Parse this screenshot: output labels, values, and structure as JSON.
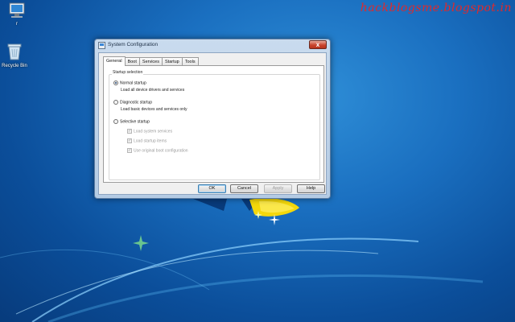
{
  "watermark": "hackblogsme.blogspot.in",
  "desktop": {
    "icons": [
      {
        "name": "computer-icon",
        "label": "r"
      },
      {
        "name": "recycle-bin-icon",
        "label": "Recycle Bin"
      }
    ]
  },
  "window": {
    "title": "System Configuration",
    "close_label": "x",
    "tabs": [
      {
        "label": "General",
        "active": true
      },
      {
        "label": "Boot",
        "active": false
      },
      {
        "label": "Services",
        "active": false
      },
      {
        "label": "Startup",
        "active": false
      },
      {
        "label": "Tools",
        "active": false
      }
    ],
    "group_title": "Startup selection",
    "options": [
      {
        "label": "Normal startup",
        "description": "Load all device drivers and services",
        "selected": true
      },
      {
        "label": "Diagnostic startup",
        "description": "Load basic devices and services only",
        "selected": false
      },
      {
        "label": "Selective startup",
        "selected": false
      }
    ],
    "selective_checks": [
      {
        "label": "Load system services",
        "checked": true
      },
      {
        "label": "Load startup items",
        "checked": true
      },
      {
        "label": "Use original boot configuration",
        "checked": true
      }
    ],
    "buttons": {
      "ok": "OK",
      "cancel": "Cancel",
      "apply": "Apply",
      "help": "Help"
    }
  }
}
